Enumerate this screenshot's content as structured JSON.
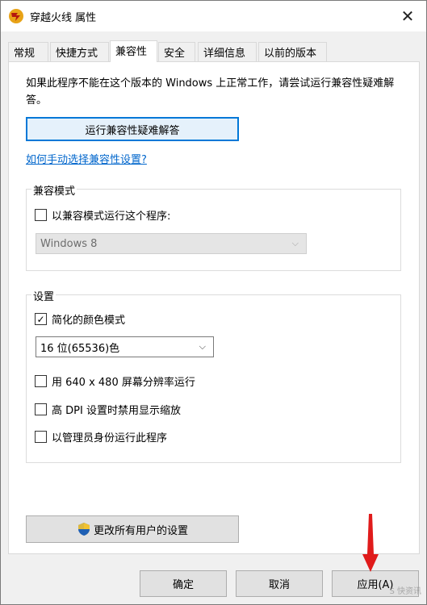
{
  "window": {
    "title": "穿越火线 属性",
    "close_glyph": "✕"
  },
  "tabs": [
    "常规",
    "快捷方式",
    "兼容性",
    "安全",
    "详细信息",
    "以前的版本"
  ],
  "active_tab": "兼容性",
  "intro": "如果此程序不能在这个版本的 Windows 上正常工作，请尝试运行兼容性疑难解答。",
  "troubleshooter_button": "运行兼容性疑难解答",
  "manual_link": "如何手动选择兼容性设置?",
  "compat_mode": {
    "label": "兼容模式",
    "checkbox_label": "以兼容模式运行这个程序:",
    "checked": false,
    "os_select": "Windows 8"
  },
  "settings": {
    "label": "设置",
    "reduced_color": {
      "label": "简化的颜色模式",
      "checked": true
    },
    "color_select": "16 位(65536)色",
    "res_640": {
      "label": "用 640 x 480 屏幕分辨率运行",
      "checked": false
    },
    "high_dpi": {
      "label": "高 DPI 设置时禁用显示缩放",
      "checked": false
    },
    "run_admin": {
      "label": "以管理员身份运行此程序",
      "checked": false
    }
  },
  "change_all_button": "更改所有用户的设置",
  "footer": {
    "ok": "确定",
    "cancel": "取消",
    "apply": "应用(A)"
  },
  "checkmark_glyph": "✓",
  "dropdown_glyph": "⌵",
  "watermark": "S 快资讯"
}
